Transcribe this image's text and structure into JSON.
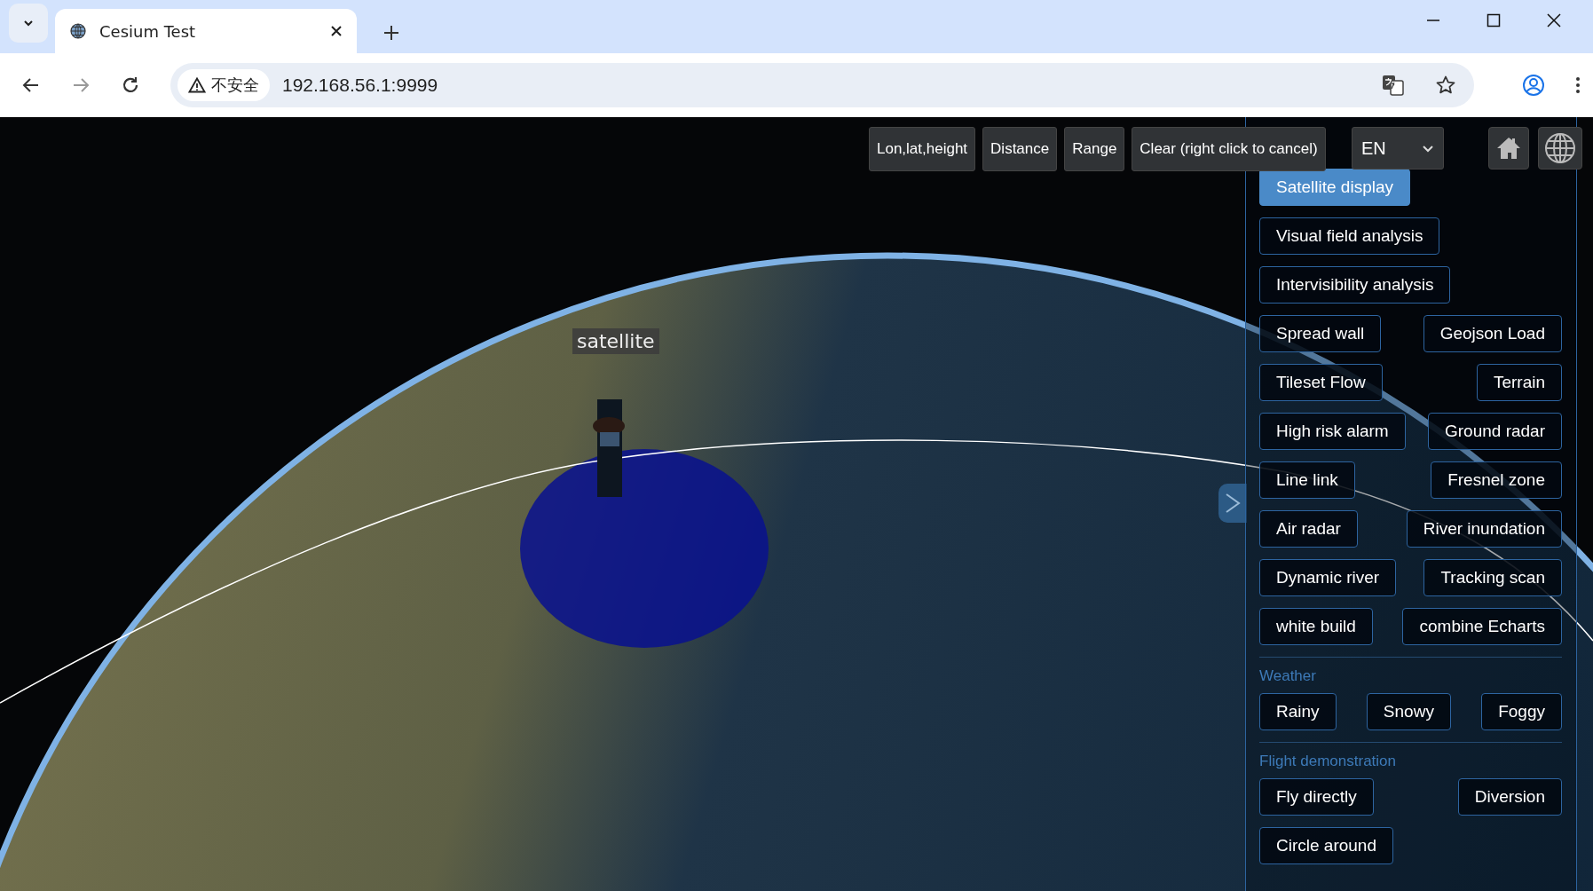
{
  "browser": {
    "tab": {
      "title": "Cesium Test"
    },
    "address": {
      "security": "不安全",
      "url": "192.168.56.1:9999"
    }
  },
  "measure_tools": [
    {
      "label": "Lon,lat,height"
    },
    {
      "label": "Distance"
    },
    {
      "label": "Range"
    },
    {
      "label": "Clear (right click to cancel)"
    }
  ],
  "language": {
    "value": "EN"
  },
  "scene": {
    "label": "satellite"
  },
  "panel": {
    "sections": [
      {
        "rows": [
          [
            {
              "label": "Satellite display",
              "selected": true
            }
          ],
          [
            {
              "label": "Visual field analysis",
              "selected": false
            }
          ],
          [
            {
              "label": "Intervisibility analysis",
              "selected": false
            }
          ],
          [
            {
              "label": "Spread wall",
              "selected": false
            },
            {
              "label": "Geojson Load",
              "selected": false
            }
          ],
          [
            {
              "label": "Tileset Flow",
              "selected": false
            },
            {
              "label": "Terrain",
              "selected": false
            }
          ],
          [
            {
              "label": "High risk alarm",
              "selected": false
            },
            {
              "label": "Ground radar",
              "selected": false
            }
          ],
          [
            {
              "label": "Line link",
              "selected": false
            },
            {
              "label": "Fresnel zone",
              "selected": false
            }
          ],
          [
            {
              "label": "Air radar",
              "selected": false
            },
            {
              "label": "River inundation",
              "selected": false
            }
          ],
          [
            {
              "label": "Dynamic river",
              "selected": false
            },
            {
              "label": "Tracking scan",
              "selected": false
            }
          ],
          [
            {
              "label": "white build",
              "selected": false
            },
            {
              "label": "combine Echarts",
              "selected": false
            }
          ]
        ]
      },
      {
        "title": "Weather",
        "rows": [
          [
            {
              "label": "Rainy",
              "selected": false
            },
            {
              "label": "Snowy",
              "selected": false
            },
            {
              "label": "Foggy",
              "selected": false
            }
          ]
        ]
      },
      {
        "title": "Flight demonstration",
        "rows": [
          [
            {
              "label": "Fly directly",
              "selected": false
            },
            {
              "label": "Diversion",
              "selected": false
            }
          ],
          [
            {
              "label": "Circle around",
              "selected": false
            }
          ]
        ]
      }
    ]
  }
}
